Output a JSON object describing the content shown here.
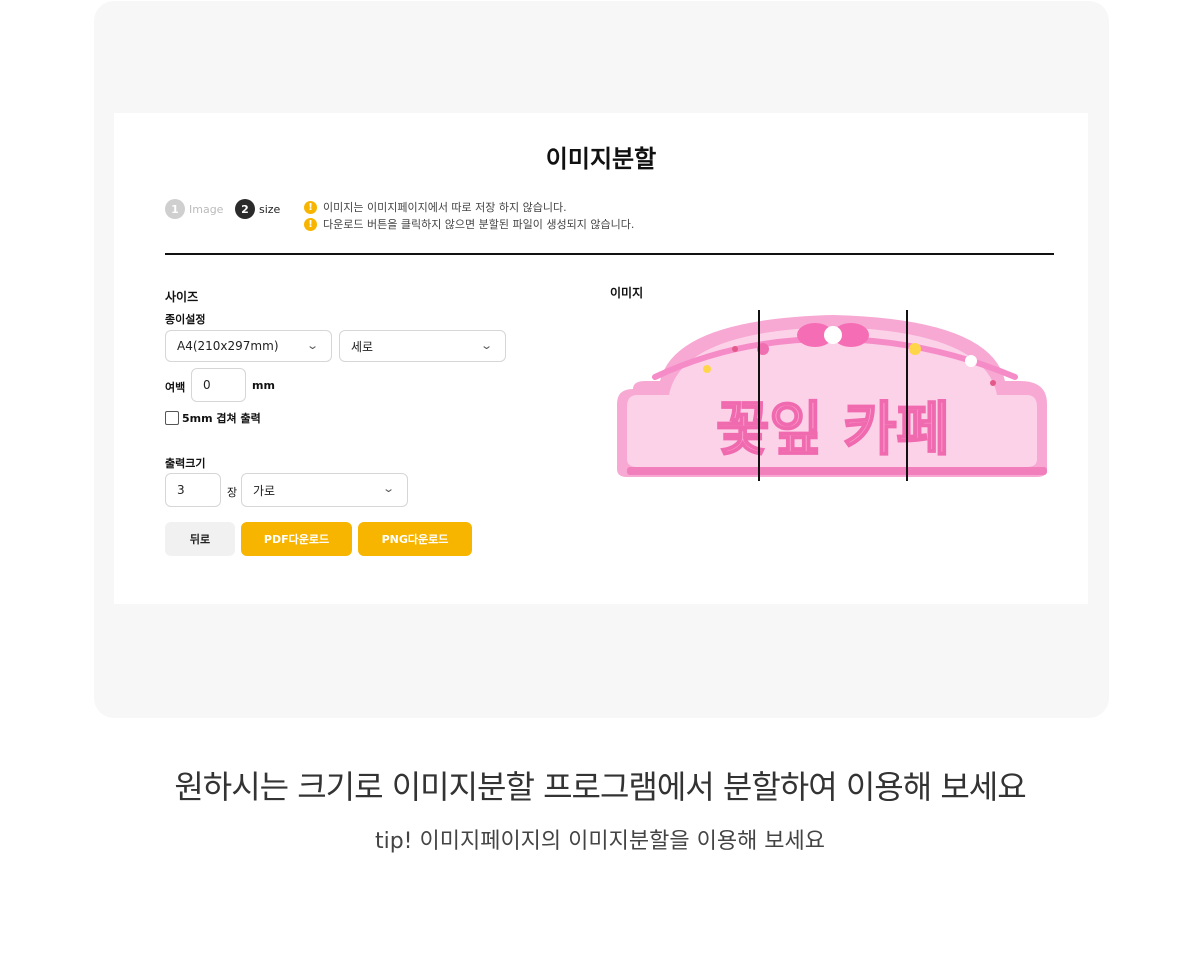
{
  "page": {
    "title": "이미지분할",
    "steps": [
      {
        "num": "1",
        "label": "Image"
      },
      {
        "num": "2",
        "label": "size"
      }
    ],
    "notices": [
      "이미지는 이미지페이지에서 따로 저장 하지 않습니다.",
      "다운로드 버튼을 클릭하지 않으면 분할된 파일이 생성되지 않습니다."
    ]
  },
  "settings": {
    "size_heading": "사이즈",
    "paper_label": "종이설정",
    "paper_size": "A4(210x297mm)",
    "orientation": "세로",
    "margin_label": "여백",
    "margin_value": "0",
    "margin_unit": "mm",
    "overlap_label": "5mm 겹쳐 출력",
    "overlap_checked": false,
    "output_label": "출력크기",
    "output_count": "3",
    "output_unit": "장",
    "output_direction": "가로"
  },
  "buttons": {
    "back": "뒤로",
    "pdf": "PDF다운로드",
    "png": "PNG다운로드"
  },
  "preview": {
    "heading": "이미지",
    "sign_text": "꽃잎 카페",
    "split_count": 3
  },
  "captions": {
    "main": "원하시는 크기로 이미지분할 프로그램에서 분할하여 이용해 보세요",
    "tip": "tip! 이미지페이지의 이미지분할을 이용해 보세요"
  },
  "colors": {
    "accent": "#f7b500",
    "step_active": "#2b2b2b",
    "sign_pink": "#f38cc4"
  }
}
